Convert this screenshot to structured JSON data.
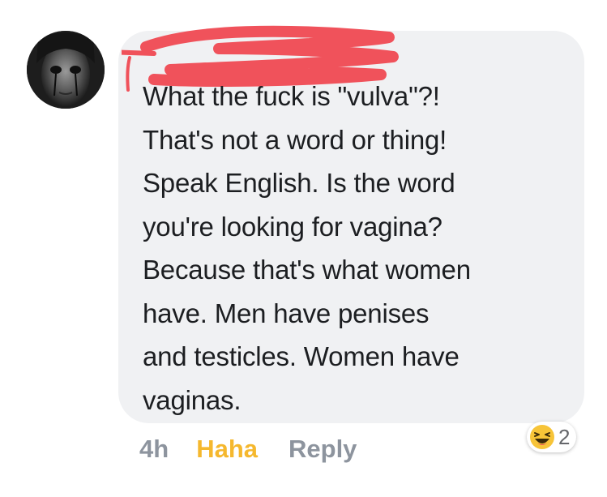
{
  "comment": {
    "lines": [
      "What the fuck is \"vulva\"?!",
      "That's not a word or thing!",
      "Speak English. Is the word",
      "you're looking for vagina?",
      "Because that's what women",
      "have. Men have penises",
      "and testicles. Women have",
      "vaginas."
    ]
  },
  "actions": {
    "time": "4h",
    "haha_label": "Haha",
    "reply_label": "Reply"
  },
  "reactions": {
    "icon": "laughing-face-icon",
    "count": "2"
  },
  "colors": {
    "bubble": "#f0f1f3",
    "text": "#1c1e21",
    "haha": "#f5b82e",
    "muted": "#8d949e",
    "redaction": "#f0525b"
  }
}
